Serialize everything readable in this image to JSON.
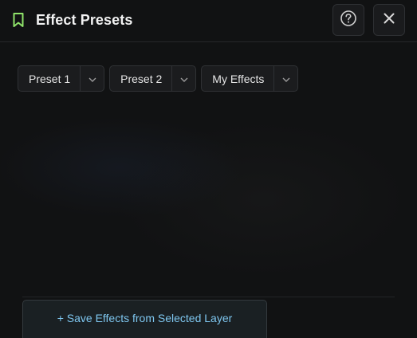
{
  "header": {
    "title": "Effect Presets",
    "icons": {
      "bookmark": "bookmark-icon",
      "help": "help-circle-icon",
      "close": "close-icon"
    }
  },
  "presets": [
    {
      "label": "Preset 1"
    },
    {
      "label": "Preset 2"
    },
    {
      "label": "My Effects"
    }
  ],
  "footer": {
    "save_label": "+ Save Effects from Selected Layer"
  },
  "colors": {
    "accent": "#8fe36a",
    "link": "#7ec6ef",
    "background": "#111213"
  }
}
